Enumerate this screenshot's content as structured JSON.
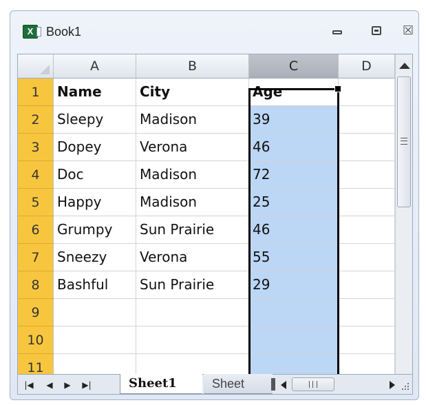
{
  "window": {
    "title": "Book1",
    "app_icon_letter": "X"
  },
  "grid": {
    "columns": [
      "A",
      "B",
      "C",
      "D"
    ],
    "selected_column": "C",
    "rows": [
      {
        "num": "1",
        "a": "Name",
        "b": "City",
        "c": "Age"
      },
      {
        "num": "2",
        "a": "Sleepy",
        "b": "Madison",
        "c": "39"
      },
      {
        "num": "3",
        "a": "Dopey",
        "b": "Verona",
        "c": "46"
      },
      {
        "num": "4",
        "a": "Doc",
        "b": "Madison",
        "c": "72"
      },
      {
        "num": "5",
        "a": "Happy",
        "b": "Madison",
        "c": "25"
      },
      {
        "num": "6",
        "a": "Grumpy",
        "b": "Sun Prairie",
        "c": "46"
      },
      {
        "num": "7",
        "a": "Sneezy",
        "b": "Verona",
        "c": "55"
      },
      {
        "num": "8",
        "a": "Bashful",
        "b": "Sun Prairie",
        "c": "29"
      },
      {
        "num": "9",
        "a": "",
        "b": "",
        "c": ""
      },
      {
        "num": "10",
        "a": "",
        "b": "",
        "c": ""
      },
      {
        "num": "11",
        "a": "",
        "b": "",
        "c": ""
      }
    ]
  },
  "sheets": {
    "active": "Sheet1",
    "other": "Sheet"
  },
  "icons": {
    "first_sheet": "first-sheet-icon",
    "prev_sheet": "prev-sheet-icon",
    "next_sheet": "next-sheet-icon",
    "last_sheet": "last-sheet-icon"
  },
  "colors": {
    "row_header": "#f8c63e",
    "selection": "#bcd6f5",
    "selected_header": "#a9afb8"
  }
}
